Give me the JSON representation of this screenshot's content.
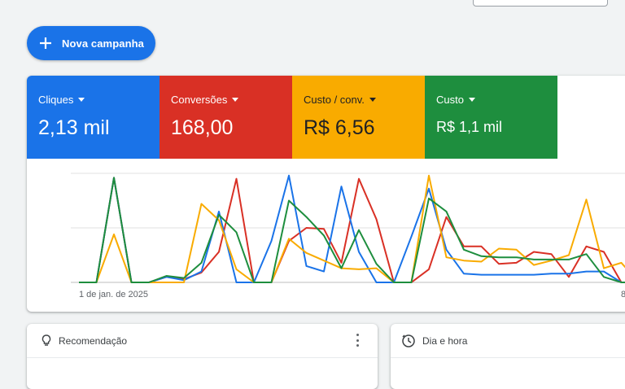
{
  "new_campaign": {
    "label": "Nova campanha"
  },
  "tiles": [
    {
      "name": "Cliques",
      "value": "2,13 mil",
      "color": "#1a73e8"
    },
    {
      "name": "Conversões",
      "value": "168,00",
      "color": "#d93025"
    },
    {
      "name": "Custo / conv.",
      "value": "R$ 6,56",
      "color": "#f9ab00"
    },
    {
      "name": "Custo",
      "value": "R$ 1,1 mil",
      "color": "#1e8e3e"
    }
  ],
  "chart_data": {
    "type": "line",
    "x_start_label": "1 de jan. de 2025",
    "x_end_label": "8",
    "series": [
      {
        "color": "#1a73e8",
        "values": [
          0,
          0,
          96,
          0,
          0,
          5,
          2,
          10,
          65,
          0,
          0,
          38,
          98,
          15,
          10,
          88,
          28,
          0,
          0,
          42,
          86,
          30,
          8,
          7,
          7,
          7,
          7,
          8,
          8,
          10,
          10,
          0,
          0
        ]
      },
      {
        "color": "#d93025",
        "values": [
          0,
          0,
          96,
          0,
          0,
          5,
          3,
          9,
          28,
          95,
          0,
          0,
          38,
          50,
          49,
          18,
          95,
          58,
          0,
          0,
          12,
          60,
          33,
          33,
          17,
          18,
          28,
          26,
          5,
          33,
          28,
          0,
          0
        ]
      },
      {
        "color": "#f9ab00",
        "values": [
          0,
          0,
          44,
          0,
          0,
          0,
          0,
          72,
          57,
          12,
          0,
          0,
          40,
          27,
          20,
          13,
          12,
          13,
          0,
          0,
          98,
          23,
          20,
          19,
          31,
          30,
          16,
          20,
          25,
          76,
          13,
          18,
          0
        ]
      },
      {
        "color": "#1e8e3e",
        "values": [
          0,
          0,
          96,
          0,
          0,
          6,
          4,
          18,
          62,
          46,
          0,
          0,
          75,
          60,
          43,
          13,
          48,
          17,
          0,
          0,
          77,
          65,
          30,
          24,
          23,
          23,
          21,
          21,
          21,
          26,
          5,
          0,
          0
        ]
      }
    ]
  },
  "panels": {
    "recommendation": {
      "title": "Recomendação"
    },
    "day_hour": {
      "title": "Dia e hora"
    }
  },
  "icons": {
    "plus": "plus-icon",
    "lightbulb": "lightbulb-icon",
    "clock": "clock-icon",
    "more": "more-vert-icon"
  }
}
